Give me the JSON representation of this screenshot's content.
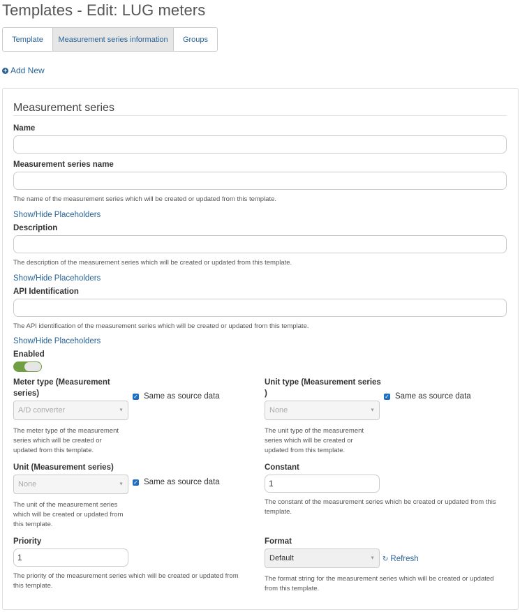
{
  "page": {
    "title": "Templates - Edit: LUG meters"
  },
  "tabs": [
    {
      "label": "Template"
    },
    {
      "label": "Measurement series information"
    },
    {
      "label": "Groups"
    }
  ],
  "actions": {
    "add_new": "Add New"
  },
  "section": {
    "title": "Measurement series"
  },
  "fields": {
    "name": {
      "label": "Name",
      "value": ""
    },
    "series_name": {
      "label": "Measurement series name",
      "value": "",
      "help": "The name of the measurement series which will be created or updated from this template.",
      "placeholder_link": "Show/Hide Placeholders"
    },
    "description": {
      "label": "Description",
      "value": "",
      "help": "The description of the measurement series which will be created or updated from this template.",
      "placeholder_link": "Show/Hide Placeholders"
    },
    "api_id": {
      "label": "API Identification",
      "value": "",
      "help": "The API identification of the measurement series which will be created or updated from this template.",
      "placeholder_link": "Show/Hide Placeholders"
    },
    "enabled": {
      "label": "Enabled",
      "checked": true
    },
    "meter_type": {
      "label_line1": "Meter type (Measurement",
      "label_line2": "series)",
      "value": "A/D converter",
      "checkbox_label": "Same as source data",
      "help_line1": "The meter type of the measurement",
      "help_line2": "series which will be created or",
      "help_line3": "updated from this template."
    },
    "unit_type": {
      "label_line1": "Unit type (Measurement series",
      "label_line2": ")",
      "value": "None",
      "checkbox_label": "Same as source data",
      "help_line1": "The unit type of the measurement",
      "help_line2": "series which will be created or",
      "help_line3": "updated from this template."
    },
    "unit": {
      "label": "Unit (Measurement series)",
      "value": "None",
      "checkbox_label": "Same as source data",
      "help_line1": "The unit of the measurement series",
      "help_line2": "which will be created or updated from",
      "help_line3": "this template."
    },
    "constant": {
      "label": "Constant",
      "value": "1",
      "help_line1": "The constant of the measurement series which be created or updated from this",
      "help_line2": "template."
    },
    "priority": {
      "label": "Priority",
      "value": "1",
      "help_line1": "The priority of the measurement series which will be created or updated from",
      "help_line2": "this template."
    },
    "format": {
      "label": "Format",
      "value": "Default",
      "refresh_label": "Refresh",
      "help_line1": "The format string for the measurement series which will be created or updated",
      "help_line2": "from this template."
    }
  },
  "colors": {
    "link": "#2a6496",
    "toggle_on": "#6f9e43",
    "checkbox": "#1e6fc0"
  }
}
